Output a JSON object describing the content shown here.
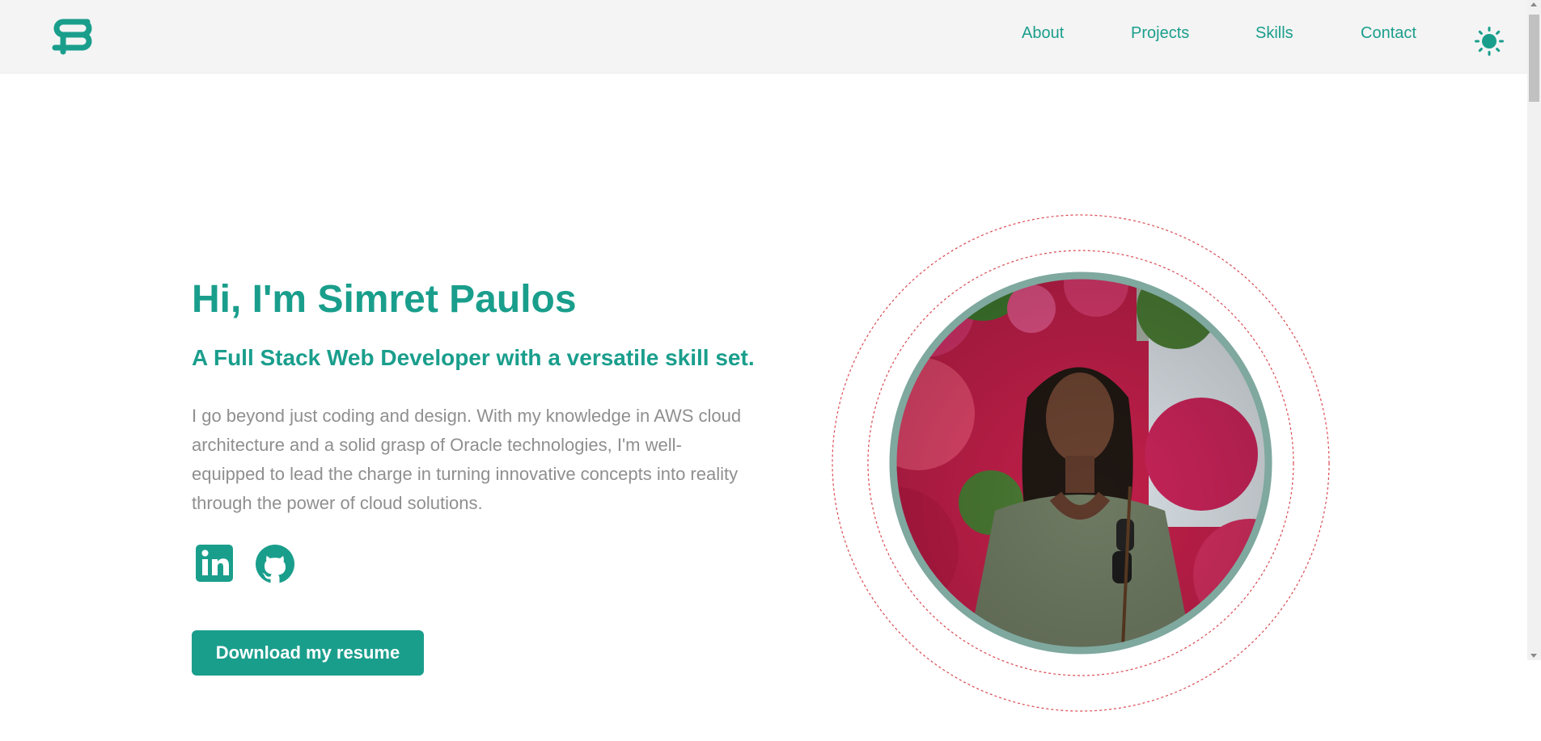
{
  "nav": {
    "links": [
      "About",
      "Projects",
      "Skills",
      "Contact"
    ]
  },
  "hero": {
    "title": "Hi, I'm Simret Paulos",
    "subtitle": "A Full Stack Web Developer with a versatile skill set.",
    "description": "I go beyond just coding and design. With my knowledge in AWS cloud architecture and a solid grasp of Oracle technologies, I'm well-equipped to lead the charge in turning innovative concepts into reality through the power of cloud solutions.",
    "resume_label": "Download my resume"
  },
  "icons": {
    "logo": "logo-icon",
    "theme": "sun-icon",
    "social": [
      "linkedin-icon",
      "github-icon"
    ]
  },
  "colors": {
    "accent": "#1a9e8c",
    "nav_bg": "#f4f4f4",
    "text_muted": "#8f8f8f",
    "ring_dashed": "#d94a52",
    "portrait_border": "#7fa89f"
  }
}
